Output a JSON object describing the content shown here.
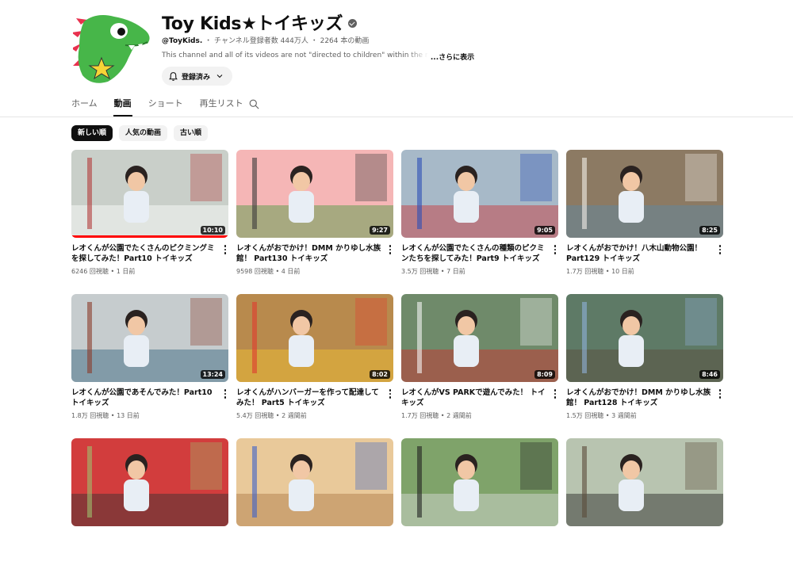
{
  "channel": {
    "name": "Toy Kids★トイキッズ",
    "handle": "@ToyKids.",
    "subscribers": "チャンネル登録者数 444万人",
    "video_count": "2264 本の動画",
    "separator": "・",
    "description": "This channel and all of its videos are not \"directed to children\" within the meaning of",
    "more_label": "...さらに表示",
    "subscribe_label": "登録済み"
  },
  "tabs": [
    {
      "label": "ホーム",
      "active": false
    },
    {
      "label": "動画",
      "active": true
    },
    {
      "label": "ショート",
      "active": false
    },
    {
      "label": "再生リスト",
      "active": false
    }
  ],
  "chips": [
    {
      "label": "新しい順",
      "active": true
    },
    {
      "label": "人気の動画",
      "active": false
    },
    {
      "label": "古い順",
      "active": false
    }
  ],
  "videos": [
    {
      "title": "レオくんが公園でたくさんのピクミングミを探してみた！Part10 トイキッズ",
      "duration": "10:10",
      "views": "6246 回視聴",
      "age": "1 日前",
      "progress": 1.0
    },
    {
      "title": "レオくんがおでかけ！DMM かりゆし水族館！ Part130 トイキッズ",
      "duration": "9:27",
      "views": "9598 回視聴",
      "age": "4 日前",
      "progress": 0
    },
    {
      "title": "レオくんが公園でたくさんの種類のピクミンたちを探してみた！Part9 トイキッズ",
      "duration": "9:05",
      "views": "3.5万 回視聴",
      "age": "7 日前",
      "progress": 0
    },
    {
      "title": "レオくんがおでかけ！八木山動物公園！ Part129 トイキッズ",
      "duration": "8:25",
      "views": "1.7万 回視聴",
      "age": "10 日前",
      "progress": 0
    },
    {
      "title": "レオくんが公園であそんでみた！Part10 トイキッズ",
      "duration": "13:24",
      "views": "1.8万 回視聴",
      "age": "13 日前",
      "progress": 0
    },
    {
      "title": "レオくんがハンバーガーを作って配達してみた！ Part5 トイキッズ",
      "duration": "8:02",
      "views": "5.4万 回視聴",
      "age": "2 週間前",
      "progress": 0
    },
    {
      "title": "レオくんがVS PARKで遊んでみた！ トイキッズ",
      "duration": "8:09",
      "views": "1.7万 回視聴",
      "age": "2 週間前",
      "progress": 0
    },
    {
      "title": "レオくんがおでかけ！DMM かりゆし水族館！ Part128 トイキッズ",
      "duration": "8:46",
      "views": "1.5万 回視聴",
      "age": "3 週間前",
      "progress": 0
    },
    {
      "title": "",
      "duration": "",
      "views": "",
      "age": "",
      "progress": 0
    },
    {
      "title": "",
      "duration": "",
      "views": "",
      "age": "",
      "progress": 0
    },
    {
      "title": "",
      "duration": "",
      "views": "",
      "age": "",
      "progress": 0
    },
    {
      "title": "",
      "duration": "",
      "views": "",
      "age": "",
      "progress": 0
    }
  ],
  "colors": {
    "accent": "#0f0f0f",
    "progress": "#ff0000",
    "avatar_dino": "#47b649",
    "avatar_spikes": "#e8314e",
    "avatar_star": "#f7d436"
  }
}
